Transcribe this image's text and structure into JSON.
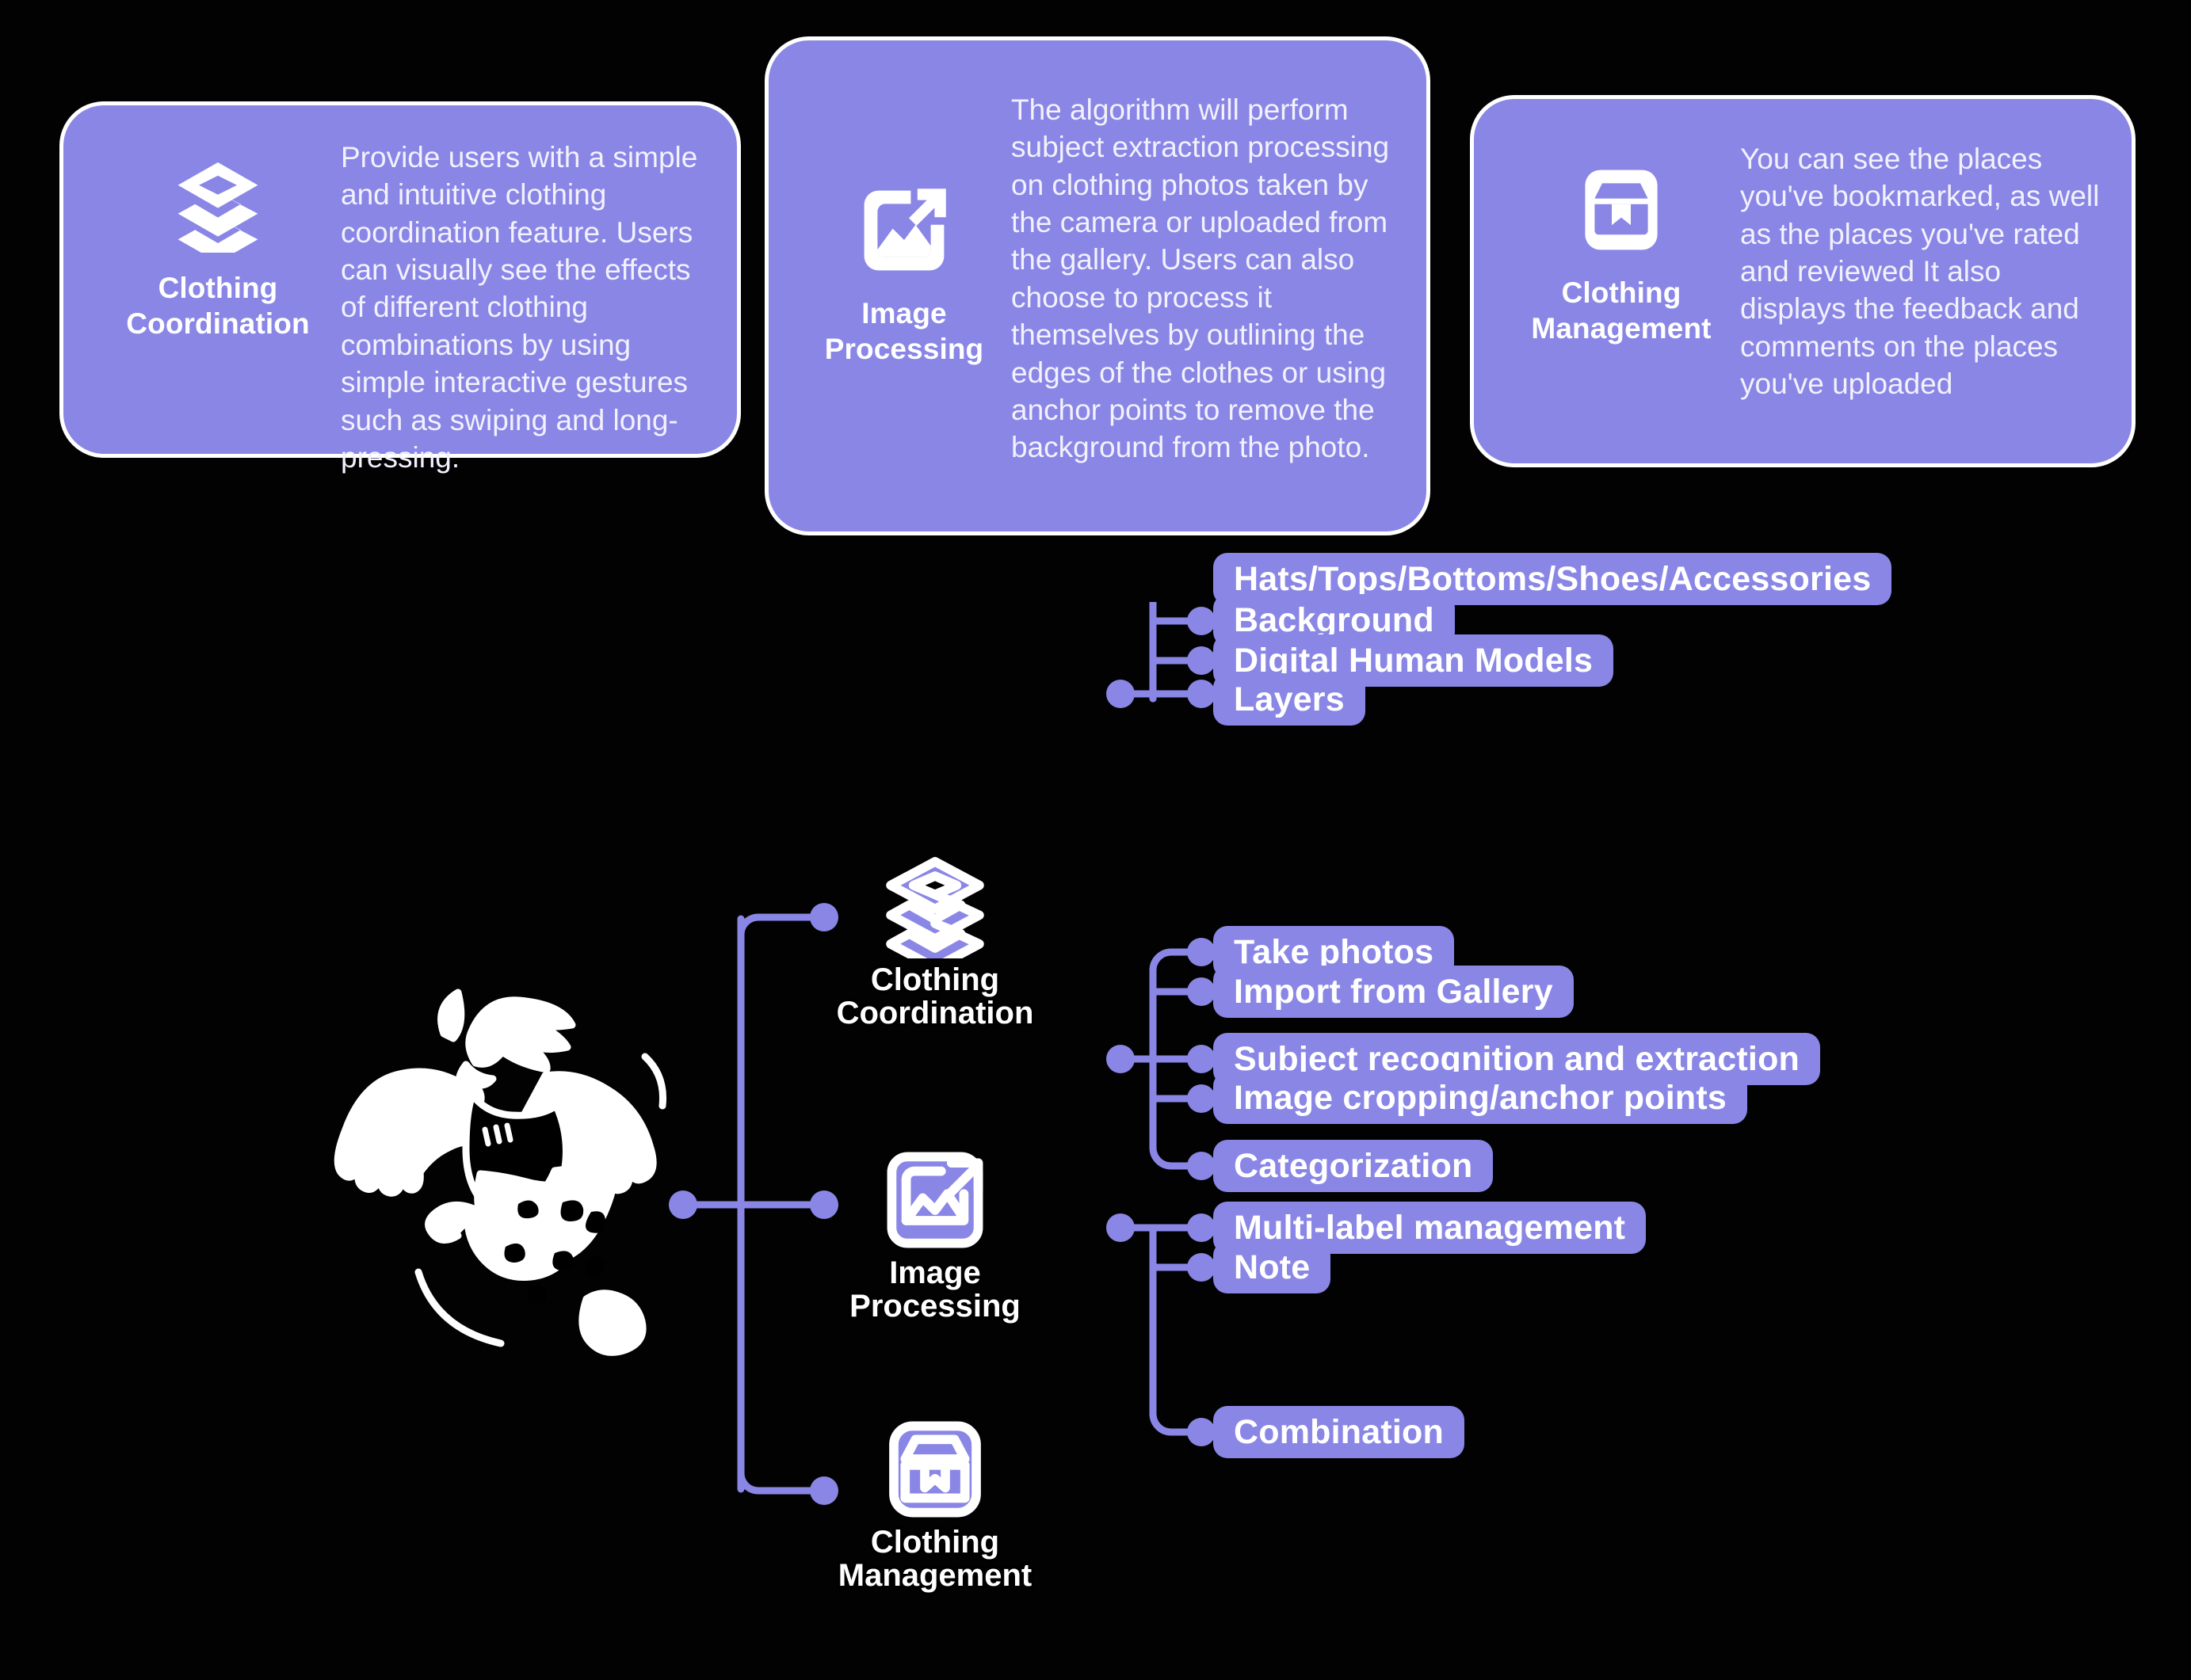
{
  "theme": {
    "background": "#000000",
    "accent": "#8a86e6",
    "card_border": "#ffffff",
    "card_text": "#f2f1fd",
    "connector": "#8a86e6"
  },
  "cards": [
    {
      "id": "clothing-coordination",
      "icon": "layers-stack-icon",
      "title": "Clothing\nCoordination",
      "title_line1": "Clothing",
      "title_line2": "Coordination",
      "body": "Provide users with a simple and intuitive clothing coordination feature. Users can visually see the effects of different clothing combinations by using simple interactive gestures such as swiping and long-pressing."
    },
    {
      "id": "image-processing",
      "icon": "image-export-icon",
      "title": "Image\nProcessing",
      "title_line1": "Image",
      "title_line2": "Processing",
      "body": "The algorithm will perform subject extraction processing on clothing photos taken by the camera or uploaded from the gallery. Users can also choose to process it themselves by outlining the edges of the clothes or using anchor points to remove the background from the photo."
    },
    {
      "id": "clothing-management",
      "icon": "box-bookmark-icon",
      "title": "Clothing\nManagement",
      "title_line1": "Clothing",
      "title_line2": "Management",
      "body": "You can see the places you've bookmarked, as well as the places you've rated and reviewed  It also displays the feedback and comments on the places you've uploaded"
    }
  ],
  "mindmap": {
    "center": {
      "illustration": "dancing-figure-illustration"
    },
    "branches": [
      {
        "id": "clothing-coordination",
        "icon": "layers-stack-icon",
        "label_line1": "Clothing",
        "label_line2": "Coordination",
        "leaves": [
          "Hats/Tops/Bottoms/Shoes/Accessories",
          "Background",
          "Digital Human Models",
          "Layers"
        ]
      },
      {
        "id": "image-processing",
        "icon": "image-export-icon",
        "label_line1": "Image",
        "label_line2": "Processing",
        "leaves": [
          "Take  photos",
          "Import from Gallery",
          "Subject recognition and extraction",
          "Image cropping/anchor points",
          "Categorization"
        ]
      },
      {
        "id": "clothing-management",
        "icon": "box-bookmark-icon",
        "label_line1": "Clothing",
        "label_line2": "Management",
        "leaves": [
          "Multi-label management",
          "Note",
          "Combination"
        ]
      }
    ]
  }
}
